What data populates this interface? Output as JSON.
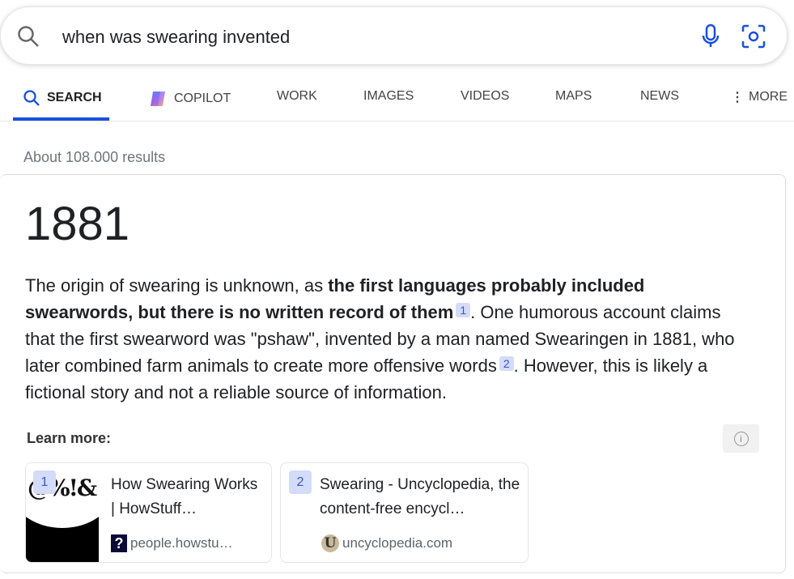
{
  "search": {
    "query": "when was swearing invented"
  },
  "tabs": [
    {
      "label": "SEARCH"
    },
    {
      "label": "COPILOT"
    },
    {
      "label": "WORK"
    },
    {
      "label": "IMAGES"
    },
    {
      "label": "VIDEOS"
    },
    {
      "label": "MAPS"
    },
    {
      "label": "NEWS"
    },
    {
      "label": "MORE"
    }
  ],
  "results_count": "About 108.000 results",
  "answer": {
    "headline": "1881",
    "p1": "The origin of swearing is unknown, as ",
    "bold": "the first languages probably included swearwords, but there is no written record of them",
    "c1": "1",
    "p2": ". One humorous account claims that the first swearword was \"pshaw\", invented by a man named Swearingen in 1881, who later combined farm animals to create more offensive words",
    "c2": "2",
    "p3": ". However, this is likely a fictional story and not a reliable source of information."
  },
  "learn_more": {
    "label": "Learn more:",
    "sources": [
      {
        "num": "1",
        "title": "How Swearing Works | HowStuff…",
        "domain": "people.howstu…",
        "thumb_text": "@%!&"
      },
      {
        "num": "2",
        "title": "Swearing - Uncyclopedia, the content-free encycl…",
        "domain": "uncyclopedia.com",
        "favicon_text": "U"
      }
    ]
  },
  "colors": {
    "accent": "#1a4fe0",
    "cite_bg": "#d3dcf8"
  }
}
